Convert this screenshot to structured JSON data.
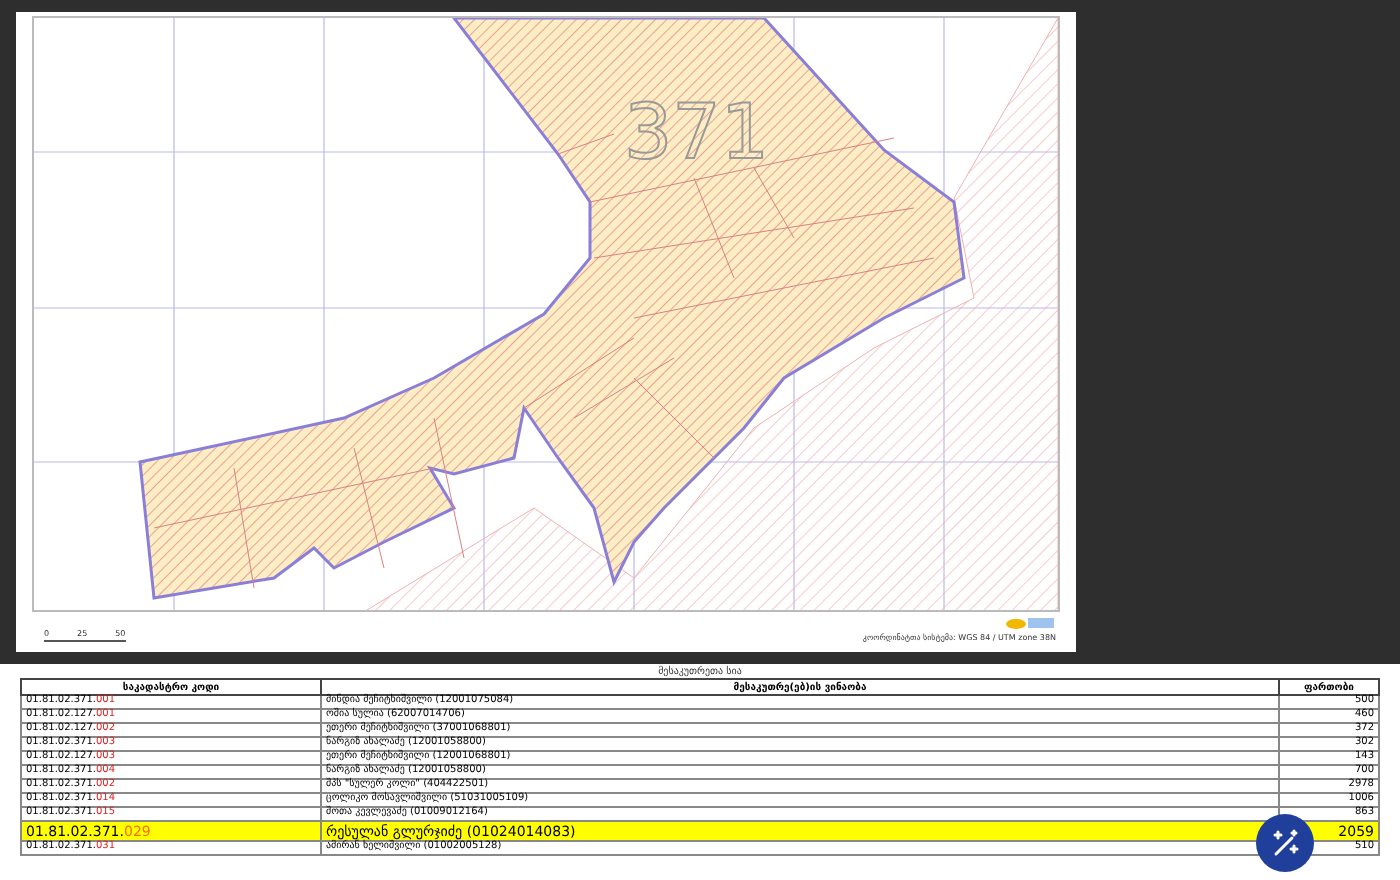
{
  "map": {
    "block_number": "371",
    "scale_labels": [
      "0",
      "25",
      "50"
    ],
    "footer": "კოორდინატთა სისტემა: WGS 84 / UTM zone 38N"
  },
  "table": {
    "title": "მესაკუთრეთა სია",
    "columns": [
      "საკადასტრო კოდი",
      "მესაკუთრე(ებ)ის ვინაობა",
      "ფართობი"
    ],
    "rows": [
      {
        "code": "01.81.02.371.",
        "suffix": "001",
        "owner": "მინდია მეჩიტხიშვილი (12001075084)",
        "area": "500",
        "highlighted": false
      },
      {
        "code": "01.81.02.127.",
        "suffix": "001",
        "owner": "ოშია სულია (62007014706)",
        "area": "460",
        "highlighted": false
      },
      {
        "code": "01.81.02.127.",
        "suffix": "002",
        "owner": "ეთერი მეჩიტხიშვილი (37001068801)",
        "area": "372",
        "highlighted": false
      },
      {
        "code": "01.81.02.371.",
        "suffix": "003",
        "owner": "ნარგიზ ახალაძე (12001058800)",
        "area": "302",
        "highlighted": false
      },
      {
        "code": "01.81.02.127.",
        "suffix": "003",
        "owner": "ეთერი მეჩიტხიშვილი (12001068801)",
        "area": "143",
        "highlighted": false
      },
      {
        "code": "01.81.02.371.",
        "suffix": "004",
        "owner": "ნარგიზ ახალაძე (12001058800)",
        "area": "700",
        "highlighted": false
      },
      {
        "code": "01.81.02.371.",
        "suffix": "002",
        "owner": "შპს \"სულერ კოლი\" (404422501)",
        "area": "2978",
        "highlighted": false
      },
      {
        "code": "01.81.02.371.",
        "suffix": "014",
        "owner": "ცოლიკო მოსავლიშვილი (51031005109)",
        "area": "1006",
        "highlighted": false
      },
      {
        "code": "01.81.02.371.",
        "suffix": "015",
        "owner": "შოთა კევლევაძე (01009012164)",
        "area": "863",
        "highlighted": false
      },
      {
        "code": "01.81.02.371.",
        "suffix": "029",
        "owner": "რესულან გლურჯიძე (01024014083)",
        "area": "2059",
        "highlighted": true
      },
      {
        "code": "01.81.02.371.",
        "suffix": "031",
        "owner": "ამირან ხელიშვილი (01002005128)",
        "area": "510",
        "highlighted": false
      }
    ]
  }
}
